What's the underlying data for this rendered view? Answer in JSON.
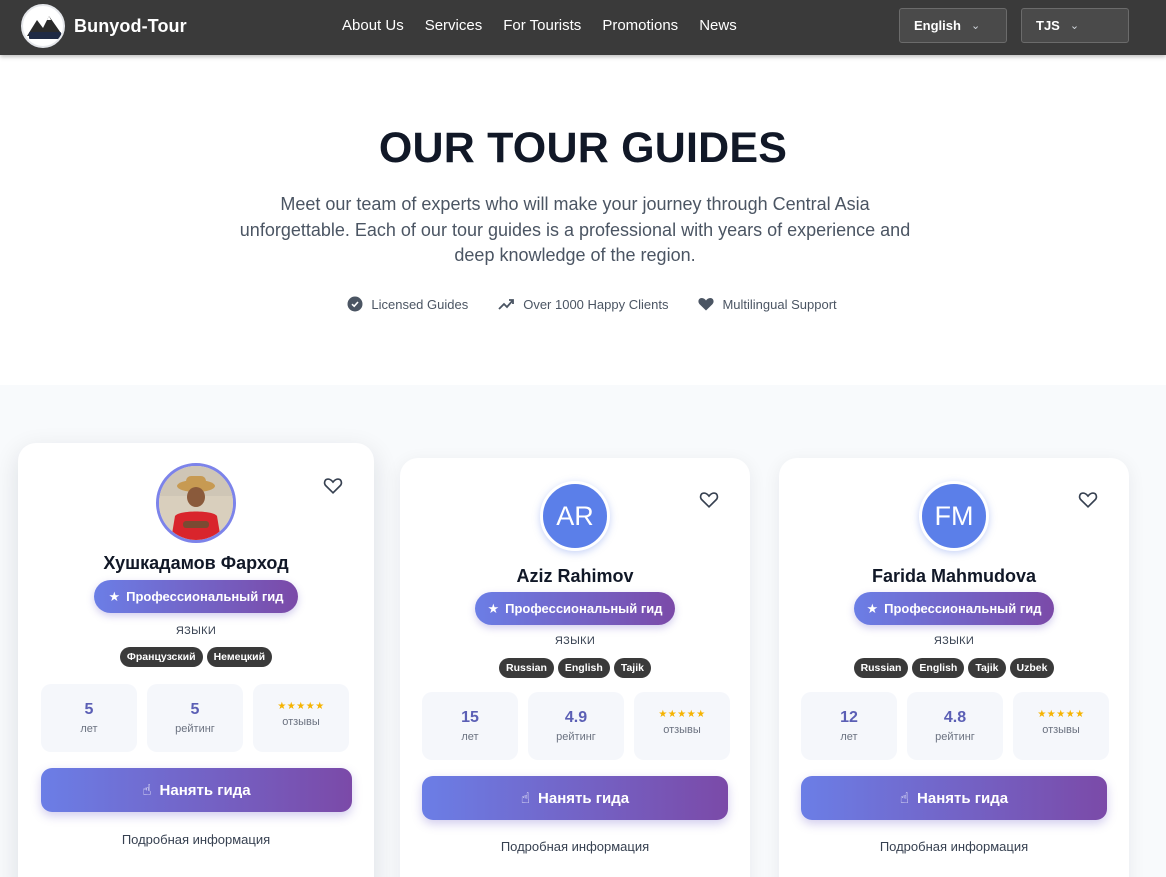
{
  "header": {
    "brand": "Bunyod-Tour",
    "nav": [
      "About Us",
      "Services",
      "For Tourists",
      "Promotions",
      "News"
    ],
    "language": "English",
    "currency": "TJS"
  },
  "hero": {
    "title": "OUR TOUR GUIDES",
    "description": "Meet our team of experts who will make your journey through Central Asia unforgettable. Each of our tour guides is a professional with years of experience and deep knowledge of the region.",
    "features": [
      "Licensed Guides",
      "Over 1000 Happy Clients",
      "Multilingual Support"
    ]
  },
  "guides": [
    {
      "name": "Хушкадамов Фарход",
      "avatar": "photo",
      "badge": "Профессиональный гид",
      "languages_title": "ЯЗЫКИ",
      "languages": [
        "Французский",
        "Немецкий"
      ],
      "years": "5",
      "years_label": "лет",
      "rating": "5",
      "rating_label": "рейтинг",
      "stars": "★★★★★",
      "reviews_label": "отзывы",
      "hire_label": "Нанять гида",
      "details_label": "Подробная информация"
    },
    {
      "name": "Aziz Rahimov",
      "avatar": "AR",
      "badge": "Профессиональный гид",
      "languages_title": "ЯЗЫКИ",
      "languages": [
        "Russian",
        "English",
        "Tajik"
      ],
      "years": "15",
      "years_label": "лет",
      "rating": "4.9",
      "rating_label": "рейтинг",
      "stars": "★★★★★",
      "reviews_label": "отзывы",
      "hire_label": "Нанять гида",
      "details_label": "Подробная информация"
    },
    {
      "name": "Farida Mahmudova",
      "avatar": "FM",
      "badge": "Профессиональный гид",
      "languages_title": "ЯЗЫКИ",
      "languages": [
        "Russian",
        "English",
        "Tajik",
        "Uzbek"
      ],
      "years": "12",
      "years_label": "лет",
      "rating": "4.8",
      "rating_label": "рейтинг",
      "stars": "★★★★★",
      "reviews_label": "отзывы",
      "hire_label": "Нанять гида",
      "details_label": "Подробная информация"
    }
  ],
  "colors": {
    "header_bg": "#3a3a3a",
    "accent_start": "#6b7ee6",
    "accent_end": "#7b4aa8",
    "avatar_bg": "#5b7fe9",
    "star": "#f5b301"
  }
}
